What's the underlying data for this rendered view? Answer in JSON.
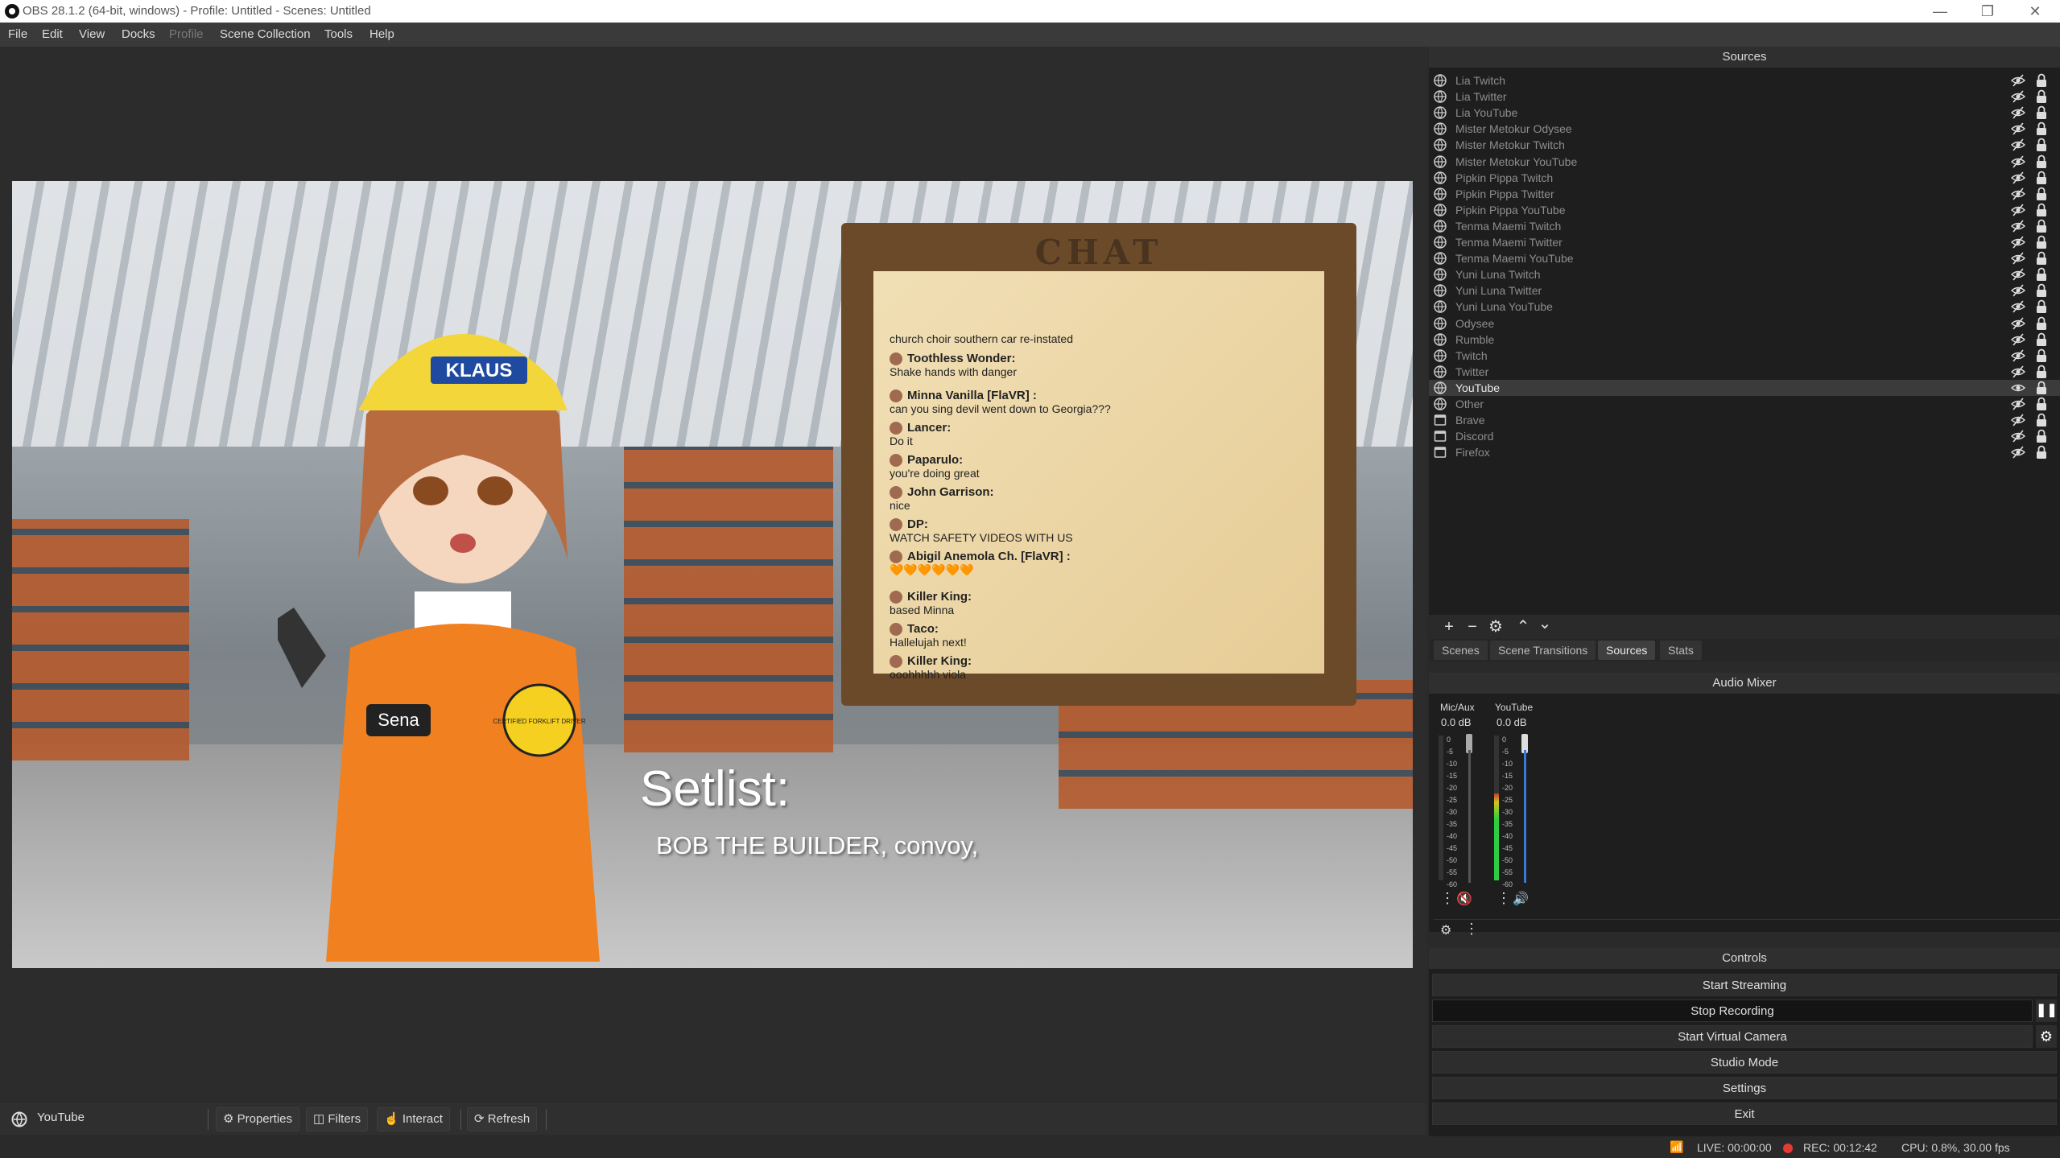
{
  "window": {
    "title": "OBS 28.1.2 (64-bit, windows) - Profile: Untitled - Scenes: Untitled"
  },
  "menu": [
    "File",
    "Edit",
    "View",
    "Docks",
    "Profile",
    "Scene Collection",
    "Tools",
    "Help"
  ],
  "menu_disabled_index": 4,
  "preview": {
    "chat_title": "CHAT",
    "chat_messages": [
      {
        "user": "",
        "text": "church choir southern car re-instated"
      },
      {
        "user": "Toothless Wonder:",
        "text": "Shake hands with danger"
      },
      {
        "user": "Minna Vanilla  [FlaVR] :",
        "text": "can you sing devil went down to Georgia???"
      },
      {
        "user": "Lancer:",
        "text": "Do it"
      },
      {
        "user": "Paparulo:",
        "text": "you're doing great"
      },
      {
        "user": "John Garrison:",
        "text": "nice"
      },
      {
        "user": "DP:",
        "text": "WATCH SAFETY VIDEOS WITH US"
      },
      {
        "user": "Abigil Anemola Ch. [FlaVR] :",
        "text": "🧡🧡🧡🧡🧡🧡"
      },
      {
        "user": "Killer King:",
        "text": "based Minna"
      },
      {
        "user": "Taco:",
        "text": "Hallelujah next!"
      },
      {
        "user": "Killer King:",
        "text": "ooohhhhh viola"
      }
    ],
    "helmet_label": "KLAUS",
    "badge_name": "Sena",
    "badge_text": "CERTIFIED FORKLIFT DRIVER",
    "setlist_title": "Setlist:",
    "setlist_songs": "BOB THE BUILDER, convoy,"
  },
  "source_toolbar": {
    "current_source": "YouTube",
    "properties": "Properties",
    "filters": "Filters",
    "interact": "Interact",
    "refresh": "Refresh"
  },
  "sources": {
    "header": "Sources",
    "items": [
      {
        "name": "Lia Twitch",
        "icon": "browser-icon",
        "visible": false
      },
      {
        "name": "Lia Twitter",
        "icon": "browser-icon",
        "visible": false
      },
      {
        "name": "Lia YouTube",
        "icon": "browser-icon",
        "visible": false
      },
      {
        "name": "Mister Metokur Odysee",
        "icon": "browser-icon",
        "visible": false
      },
      {
        "name": "Mister Metokur Twitch",
        "icon": "browser-icon",
        "visible": false
      },
      {
        "name": "Mister Metokur YouTube",
        "icon": "browser-icon",
        "visible": false
      },
      {
        "name": "Pipkin Pippa Twitch",
        "icon": "browser-icon",
        "visible": false
      },
      {
        "name": "Pipkin Pippa Twitter",
        "icon": "browser-icon",
        "visible": false
      },
      {
        "name": "Pipkin Pippa YouTube",
        "icon": "browser-icon",
        "visible": false
      },
      {
        "name": "Tenma Maemi Twitch",
        "icon": "browser-icon",
        "visible": false
      },
      {
        "name": "Tenma Maemi Twitter",
        "icon": "browser-icon",
        "visible": false
      },
      {
        "name": "Tenma Maemi YouTube",
        "icon": "browser-icon",
        "visible": false
      },
      {
        "name": "Yuni Luna Twitch",
        "icon": "browser-icon",
        "visible": false
      },
      {
        "name": "Yuni Luna Twitter",
        "icon": "browser-icon",
        "visible": false
      },
      {
        "name": "Yuni Luna YouTube",
        "icon": "browser-icon",
        "visible": false
      },
      {
        "name": "Odysee",
        "icon": "browser-icon",
        "visible": false
      },
      {
        "name": "Rumble",
        "icon": "browser-icon",
        "visible": false
      },
      {
        "name": "Twitch",
        "icon": "browser-icon",
        "visible": false
      },
      {
        "name": "Twitter",
        "icon": "browser-icon",
        "visible": false
      },
      {
        "name": "YouTube",
        "icon": "browser-icon",
        "visible": true,
        "selected": true
      },
      {
        "name": "Other",
        "icon": "browser-icon",
        "visible": false
      },
      {
        "name": "Brave",
        "icon": "window-capture-icon",
        "visible": false
      },
      {
        "name": "Discord",
        "icon": "window-capture-icon",
        "visible": false
      },
      {
        "name": "Firefox",
        "icon": "window-capture-icon",
        "visible": false
      }
    ]
  },
  "dock_tabs": [
    "Scenes",
    "Scene Transitions",
    "Sources",
    "Stats"
  ],
  "dock_tab_active": 2,
  "audio_mixer": {
    "header": "Audio Mixer",
    "channels": [
      {
        "name": "Mic/Aux",
        "db": "0.0 dB",
        "muted": true,
        "level": 0
      },
      {
        "name": "YouTube",
        "db": "0.0 dB",
        "muted": false,
        "level": 0.6
      }
    ],
    "scale": [
      "0",
      "-5",
      "-10",
      "-15",
      "-20",
      "-25",
      "-30",
      "-35",
      "-40",
      "-45",
      "-50",
      "-55",
      "-60"
    ]
  },
  "controls": {
    "header": "Controls",
    "start_streaming": "Start Streaming",
    "stop_recording": "Stop Recording",
    "start_virtual_camera": "Start Virtual Camera",
    "studio_mode": "Studio Mode",
    "settings": "Settings",
    "exit": "Exit"
  },
  "status": {
    "live": "LIVE: 00:00:00",
    "rec": "REC: 00:12:42",
    "cpu": "CPU: 0.8%, 30.00 fps"
  },
  "colors": {
    "accent_rec": "#e53935",
    "meter_green": "#2ecc40",
    "meter_yellow": "#d4c21d",
    "meter_red": "#c0392b",
    "volume_blue": "#3a78d8"
  }
}
